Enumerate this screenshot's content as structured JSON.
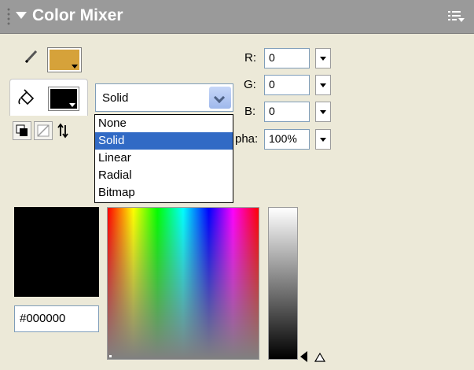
{
  "panel": {
    "title": "Color Mixer"
  },
  "colors": {
    "stroke": "#d6a23a",
    "fill": "#000000",
    "titlebar": "#9a9a9a",
    "highlight": "#316ac5"
  },
  "type_dropdown": {
    "selected": "Solid",
    "options": [
      "None",
      "Solid",
      "Linear",
      "Radial",
      "Bitmap"
    ]
  },
  "rgb": {
    "r_label": "R:",
    "r_value": "0",
    "g_label": "G:",
    "g_value": "0",
    "b_label": "B:",
    "b_value": "0",
    "alpha_label": "pha:",
    "alpha_value": "100%"
  },
  "hex": {
    "value": "#000000"
  },
  "icons": [
    "pencil-icon",
    "paint-bucket-icon",
    "black-white-icon",
    "no-color-icon",
    "swap-colors-icon",
    "panel-menu-icon"
  ]
}
